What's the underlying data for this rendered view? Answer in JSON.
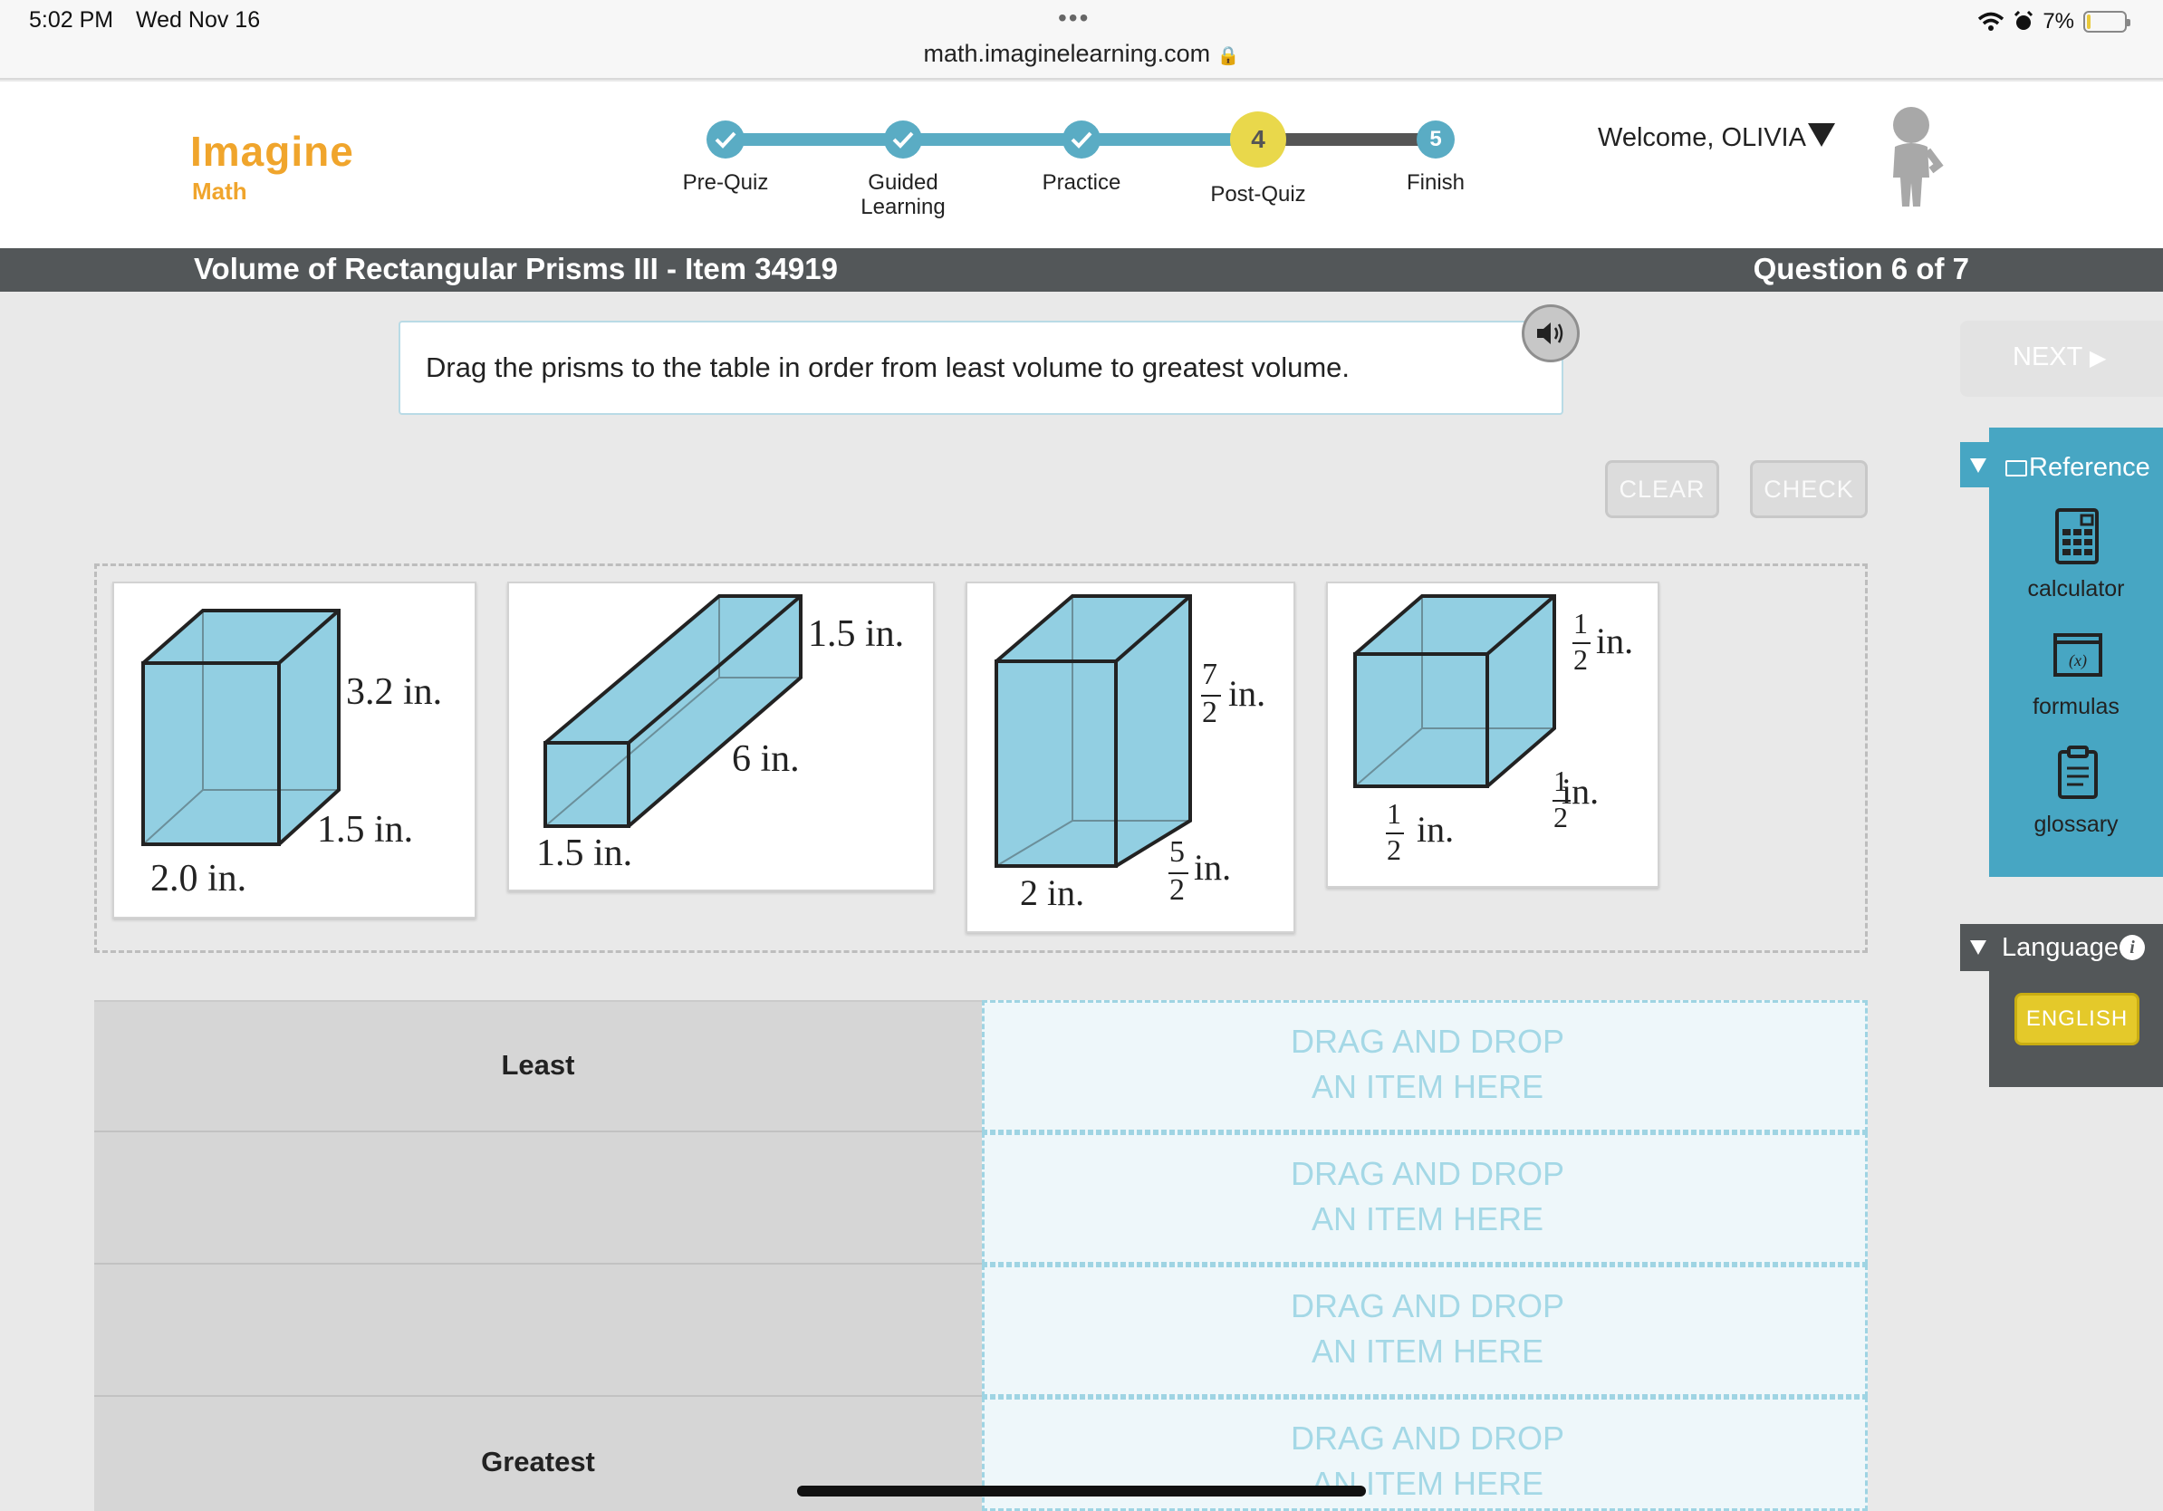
{
  "status_bar": {
    "time": "5:02 PM",
    "date": "Wed Nov 16",
    "url": "math.imaginelearning.com",
    "battery": "7%",
    "icons": [
      "wifi-icon",
      "alarm-icon",
      "battery-icon",
      "lock-icon"
    ]
  },
  "logo": {
    "main": "Imagine",
    "sub": "Math",
    "color": "#f0a52c"
  },
  "progress": {
    "steps": [
      {
        "label": "Pre-Quiz",
        "state": "complete"
      },
      {
        "label": "Guided Learning",
        "state": "complete"
      },
      {
        "label": "Practice",
        "state": "complete"
      },
      {
        "label": "Post-Quiz",
        "state": "current",
        "number": "4"
      },
      {
        "label": "Finish",
        "state": "upcoming",
        "number": "5"
      }
    ]
  },
  "user": {
    "welcome": "Welcome, OLIVIA"
  },
  "lesson": {
    "title": "Volume of Rectangular Prisms III - Item 34919",
    "question": "Question 6 of 7"
  },
  "instruction": "Drag the prisms to the table in order from least volume to greatest volume.",
  "buttons": {
    "clear": "CLEAR",
    "check": "CHECK",
    "next": "NEXT"
  },
  "prisms": [
    {
      "labels": {
        "height": "3.2 in.",
        "depth": "1.5 in.",
        "width": "2.0 in."
      }
    },
    {
      "labels": {
        "top": "1.5 in.",
        "length": "6 in.",
        "width": "1.5 in."
      }
    },
    {
      "labels": {
        "height": "in.",
        "height_num": "7",
        "height_den": "2",
        "depth": "in.",
        "depth_num": "5",
        "depth_den": "2",
        "width": "2 in."
      }
    },
    {
      "labels": {
        "height": "in.",
        "height_num": "1",
        "height_den": "2",
        "depth": "in.",
        "depth_num": "1",
        "depth_den": "2",
        "width": "in.",
        "width_num": "1",
        "width_den": "2"
      }
    }
  ],
  "table": {
    "rows": [
      {
        "label": "Least",
        "drop_line1": "DRAG AND DROP",
        "drop_line2": "AN ITEM HERE"
      },
      {
        "label": "",
        "drop_line1": "DRAG AND DROP",
        "drop_line2": "AN ITEM HERE"
      },
      {
        "label": "",
        "drop_line1": "DRAG AND DROP",
        "drop_line2": "AN ITEM HERE"
      },
      {
        "label": "Greatest",
        "drop_line1": "DRAG AND DROP",
        "drop_line2": "AN ITEM HERE"
      }
    ]
  },
  "side_panel": {
    "reference_title": "Reference",
    "tools": [
      {
        "label": "calculator",
        "icon": "calculator-icon"
      },
      {
        "label": "formulas",
        "icon": "formulas-icon"
      },
      {
        "label": "glossary",
        "icon": "glossary-icon"
      }
    ],
    "language_title": "Language",
    "language_button": "ENGLISH"
  },
  "colors": {
    "accent_teal": "#47a6c3",
    "progress_done": "#5aacc4",
    "current_step": "#e9d84b",
    "prism_fill": "#92cfe2",
    "title_bar": "#535759"
  }
}
